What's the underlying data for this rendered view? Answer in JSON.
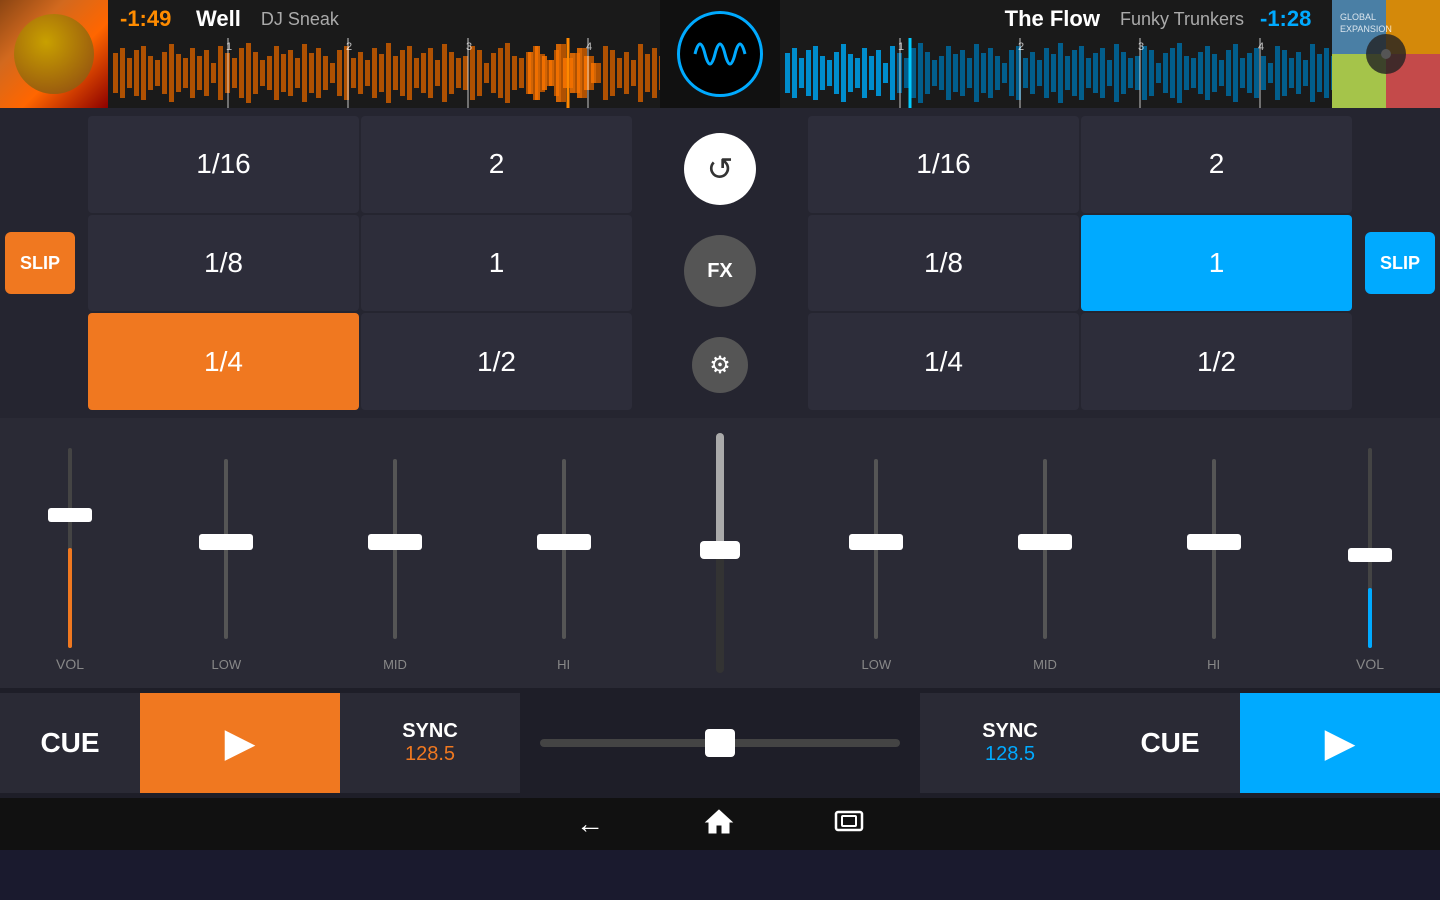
{
  "header": {
    "left_deck": {
      "time": "-1:49",
      "title": "Well",
      "artist": "DJ Sneak"
    },
    "right_deck": {
      "time": "-1:28",
      "title": "The Flow",
      "artist": "Funky Trunkers"
    },
    "logo_wave": "〜"
  },
  "left_loop": {
    "slip_label": "SLIP",
    "buttons": [
      {
        "label": "1/16",
        "active": false
      },
      {
        "label": "2",
        "active": false
      },
      {
        "label": "1/8",
        "active": false
      },
      {
        "label": "1",
        "active": false
      },
      {
        "label": "1/4",
        "active": true
      },
      {
        "label": "1/2",
        "active": false
      }
    ]
  },
  "right_loop": {
    "slip_label": "SLIP",
    "buttons": [
      {
        "label": "1/16",
        "active": false
      },
      {
        "label": "2",
        "active": false
      },
      {
        "label": "1/8",
        "active": false
      },
      {
        "label": "1",
        "active": true
      },
      {
        "label": "1/4",
        "active": false
      },
      {
        "label": "1/2",
        "active": false
      }
    ]
  },
  "center_controls": {
    "reset_icon": "↺",
    "fx_label": "FX",
    "settings_icon": "⚙"
  },
  "mixer": {
    "left_vol_label": "VOL",
    "right_vol_label": "VOL",
    "left_eq": [
      {
        "label": "LOW"
      },
      {
        "label": "MID"
      },
      {
        "label": "HI"
      }
    ],
    "right_eq": [
      {
        "label": "LOW"
      },
      {
        "label": "MID"
      },
      {
        "label": "HI"
      }
    ]
  },
  "bottom": {
    "left_cue": "CUE",
    "right_cue": "CUE",
    "left_sync_label": "SYNC",
    "left_sync_bpm": "128.5",
    "right_sync_label": "SYNC",
    "right_sync_bpm": "128.5",
    "play_icon": "▶"
  },
  "navbar": {
    "back_icon": "←",
    "home_icon": "⌂",
    "recent_icon": "▭"
  }
}
